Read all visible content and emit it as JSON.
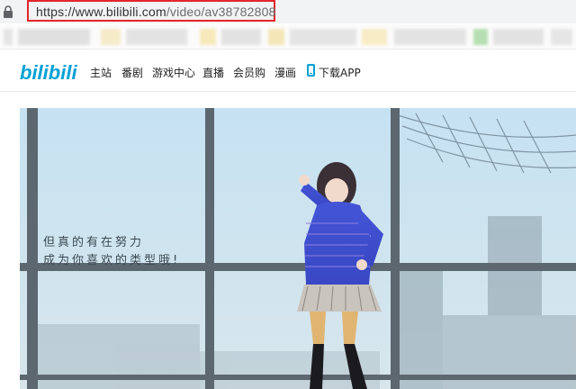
{
  "browser": {
    "url_host": "https://www.bilibili.com",
    "url_path": "/video/av38782808",
    "lock_icon": "lock-icon"
  },
  "nav": {
    "logo_text": "bilibili",
    "items": [
      "主站",
      "番剧",
      "游戏中心",
      "直播",
      "会员购",
      "漫画"
    ],
    "download_app": "下载APP",
    "accent_color": "#00a1d6"
  },
  "banner": {
    "slogan_line1": "但真的有在努力",
    "slogan_line2": "成为你喜欢的类型哦!"
  }
}
